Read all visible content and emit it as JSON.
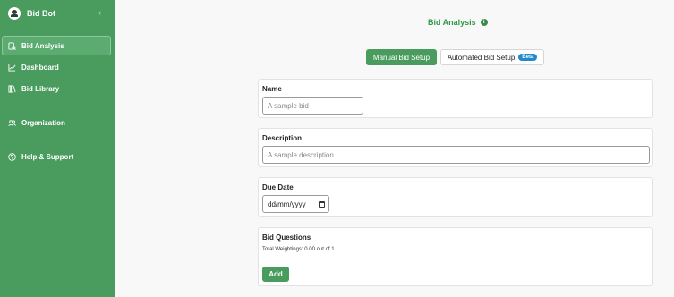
{
  "sidebar": {
    "brand": "Bid Bot",
    "collapse_glyph": "‹",
    "items": [
      {
        "label": "Bid Analysis",
        "icon": "bid-analysis-icon"
      },
      {
        "label": "Dashboard",
        "icon": "chart-icon"
      },
      {
        "label": "Bid Library",
        "icon": "library-icon"
      },
      {
        "label": "Organization",
        "icon": "users-icon"
      },
      {
        "label": "Help & Support",
        "icon": "help-icon"
      }
    ],
    "active_item": "Bid Analysis"
  },
  "main": {
    "title": "Bid Analysis",
    "info_glyph": "i",
    "tabs": {
      "manual": "Manual Bid Setup",
      "automated": "Automated Bid Setup",
      "automated_badge": "Beta"
    },
    "name": {
      "label": "Name",
      "placeholder": "A sample bid"
    },
    "description": {
      "label": "Description",
      "placeholder": "A sample description"
    },
    "due_date": {
      "label": "Due Date",
      "value": "dd/mm/yyyy"
    },
    "questions": {
      "label": "Bid Questions",
      "weightings": "Total Weightings: 0.00 out of 1",
      "add_label": "Add"
    }
  },
  "colors": {
    "sidebar_bg": "#4a9c5e",
    "accent": "#2e9a4a",
    "beta_badge": "#1f8bc9"
  }
}
